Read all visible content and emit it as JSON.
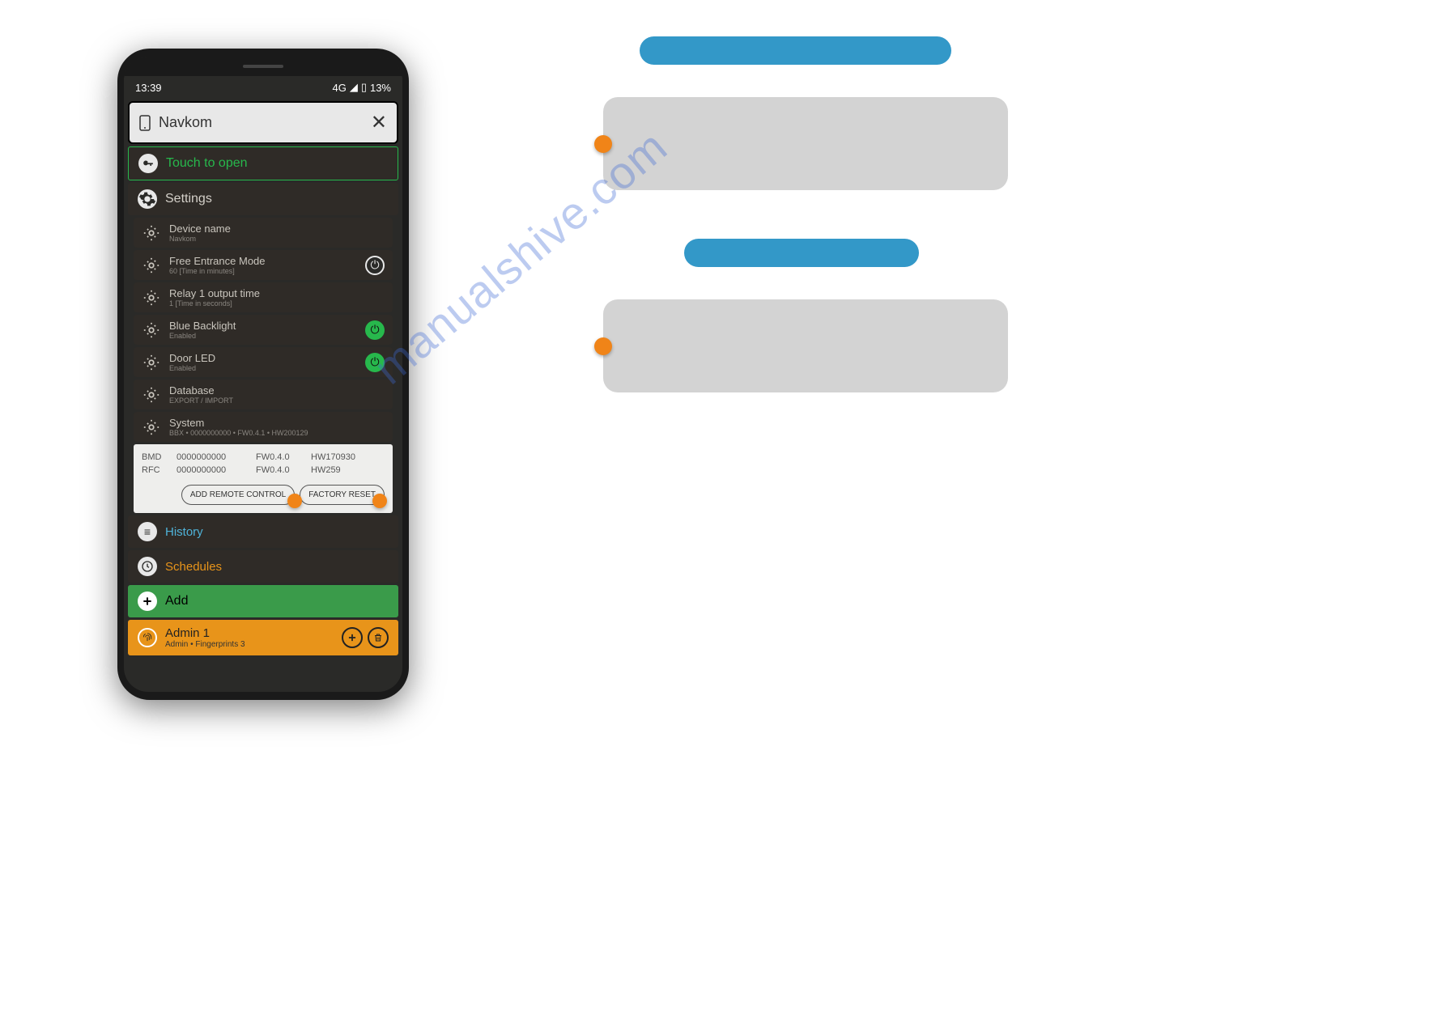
{
  "status": {
    "time": "13:39",
    "network": "4G",
    "battery": "13%"
  },
  "header": {
    "title": "Navkom"
  },
  "touch_row": {
    "label": "Touch to open"
  },
  "settings_header": {
    "label": "Settings"
  },
  "settings": {
    "device_name": {
      "title": "Device name",
      "sub": "Navkom"
    },
    "free_entrance": {
      "title": "Free Entrance Mode",
      "sub": "60 [Time in minutes]"
    },
    "relay": {
      "title": "Relay 1 output time",
      "sub": "1 [Time in seconds]"
    },
    "backlight": {
      "title": "Blue Backlight",
      "sub": "Enabled"
    },
    "door_led": {
      "title": "Door LED",
      "sub": "Enabled"
    },
    "database": {
      "title": "Database",
      "sub": "EXPORT / IMPORT"
    },
    "system": {
      "title": "System",
      "sub": "BBX • 0000000000 • FW0.4.1 • HW200129"
    }
  },
  "info_panel": {
    "row1": {
      "c1": "BMD",
      "c2": "0000000000",
      "c3": "FW0.4.0",
      "c4": "HW170930"
    },
    "row2": {
      "c1": "RFC",
      "c2": "0000000000",
      "c3": "FW0.4.0",
      "c4": "HW259"
    },
    "btn_add_remote": "ADD REMOTE CONTROL",
    "btn_factory_reset": "FACTORY RESET"
  },
  "history": {
    "label": "History"
  },
  "schedules": {
    "label": "Schedules"
  },
  "add": {
    "label": "Add"
  },
  "admin": {
    "title": "Admin 1",
    "sub": "Admin • Fingerprints 3"
  },
  "watermark": "manualshive.com"
}
